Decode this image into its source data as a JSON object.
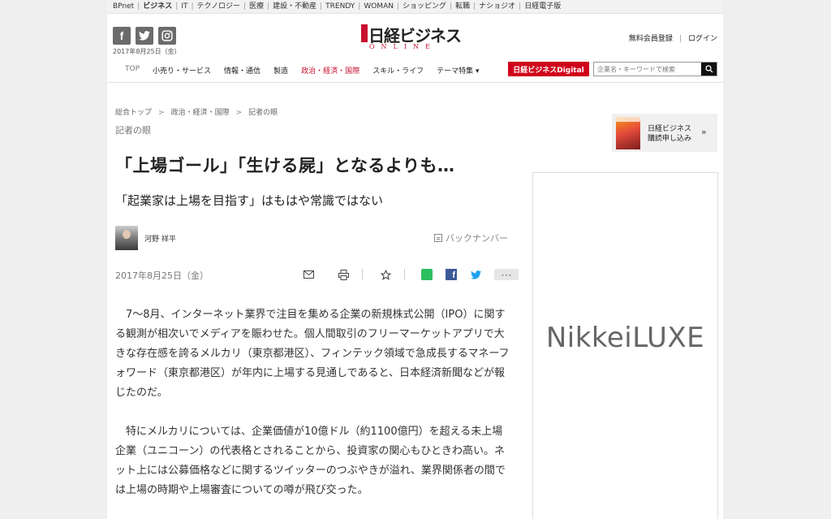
{
  "netbar": {
    "items": [
      "BPnet",
      "ビジネス",
      "IT",
      "テクノロジー",
      "医療",
      "建設・不動産",
      "TRENDY",
      "WOMAN",
      "ショッピング",
      "転職",
      "ナショジオ",
      "日経電子版"
    ],
    "active_index": 1
  },
  "header": {
    "social_icons": [
      "facebook-icon",
      "twitter-icon",
      "instagram-icon"
    ],
    "date": "2017年8月25日（金）",
    "logo_main": "日経ビジネス",
    "logo_sub": "ONLINE",
    "register_label": "無料会員登録",
    "login_label": "ログイン"
  },
  "nav": {
    "items": [
      "TOP",
      "小売り・サービス",
      "情報・通信",
      "製造",
      "政治・経済・国際",
      "スキル・ライフ",
      "テーマ特集 ▾"
    ],
    "active_index": 4,
    "digital_label": "日経ビジネスDigital",
    "search_placeholder": "企業名・キーワードで検索"
  },
  "breadcrumb": {
    "items": [
      "総合トップ",
      "政治・経済・国際",
      "記者の眼"
    ]
  },
  "article": {
    "section": "記者の眼",
    "title": "「上場ゴール」「生ける屍」となるよりも…",
    "subtitle": "「起業家は上場を目指す」はもはや常識ではない",
    "author": "河野 祥平",
    "backnumber_label": "バックナンバー",
    "date": "2017年8月25日（金）",
    "share_more": "･･･",
    "paragraphs": [
      "7～8月、インターネット業界で注目を集める企業の新規株式公開（IPO）に関する観測が相次いでメディアを賑わせた。個人間取引のフリーマーケットアプリで大きな存在感を誇るメルカリ（東京都港区）、フィンテック領域で急成長するマネーフォワード（東京都港区）が年内に上場する見通しであると、日本経済新聞などが報じたのだ。",
      "特にメルカリについては、企業価値が10億ドル（約1100億円）を超える未上場企業（ユニコーン）の代表格とされることから、投資家の関心もひときわ高い。ネット上には公募価格などに関するツイッターのつぶやきが溢れ、業界関係者の間では上場の時期や上場審査についての噂が飛び交った。"
    ]
  },
  "sidebar": {
    "subscribe_line1": "日経ビジネス",
    "subscribe_line2": "購読申し込み",
    "subscribe_chevron": "»",
    "ad_brand": "NikkeiLUXE"
  },
  "colors": {
    "accent_red": "#c8102e",
    "digital_bg": "#d0021b",
    "evernote": "#2dbe60",
    "facebook": "#3b5998",
    "twitter": "#1da1f2"
  }
}
